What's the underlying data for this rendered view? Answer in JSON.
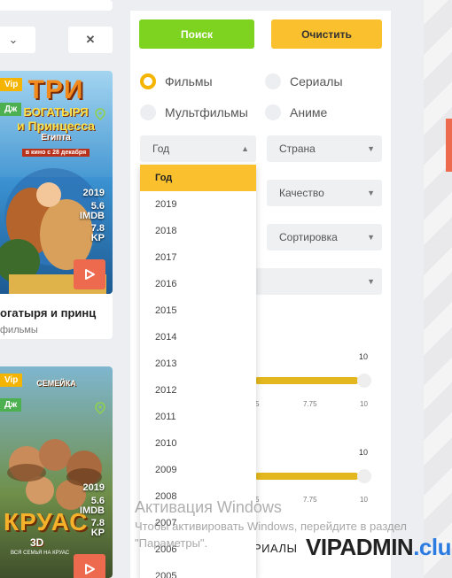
{
  "filters": {
    "search_label": "Поиск",
    "clear_label": "Очистить",
    "type_options": [
      {
        "label": "Фильмы",
        "selected": true
      },
      {
        "label": "Сериалы",
        "selected": false
      },
      {
        "label": "Мультфильмы",
        "selected": false
      },
      {
        "label": "Аниме",
        "selected": false
      }
    ],
    "year_select": "Год",
    "country_select": "Страна",
    "quality_select": "Качество",
    "sort_select": "Сортировка",
    "year_options": [
      "Год",
      "2019",
      "2018",
      "2017",
      "2016",
      "2015",
      "2014",
      "2013",
      "2012",
      "2011",
      "2010",
      "2009",
      "2008",
      "2007",
      "2006",
      "2005"
    ],
    "slider1": {
      "max_label": "10",
      "ticks": [
        "5",
        "7.75",
        "10"
      ],
      "fill_fraction": 1.0
    },
    "slider2": {
      "max_label": "10",
      "ticks": [
        "5",
        "7.75",
        "10"
      ],
      "fill_fraction": 1.0
    },
    "serials_label": "РИАЛЫ"
  },
  "cards": [
    {
      "poster_text": [
        "ТРИ",
        "БОГАТЫРЯ",
        "и Принцесса",
        "Египта",
        "в кино с 28 декабря"
      ],
      "badge_vip": "Vip",
      "badge_sub": "Дж",
      "year": "2019",
      "imdb_value": "5.6",
      "imdb_label": "IMDB",
      "kp_value": "7.8",
      "kp_label": "KP",
      "title": "огатыря и принц",
      "genre": "фильмы",
      "colors": {
        "bg": "#2f84c4",
        "accent": "#e8561f"
      }
    },
    {
      "poster_text": [
        "СЕМЕЙКА",
        "КРУАС",
        "3D",
        "ВСЯ СЕМЬЯ НА КРУАС"
      ],
      "badge_vip": "Vip",
      "badge_sub": "Дж",
      "year": "2019",
      "imdb_value": "5.6",
      "imdb_label": "IMDB",
      "kp_value": "7.8",
      "kp_label": "KP",
      "colors": {
        "bg": "#6fa0b8",
        "accent": "#e39a35"
      }
    }
  ],
  "windows_activation": {
    "title": "Активация Windows",
    "subtitle": "Чтобы активировать Windows, перейдите в раздел \"Параметры\"."
  },
  "watermark": {
    "main": "VIPADMIN",
    "suffix": ".club"
  }
}
